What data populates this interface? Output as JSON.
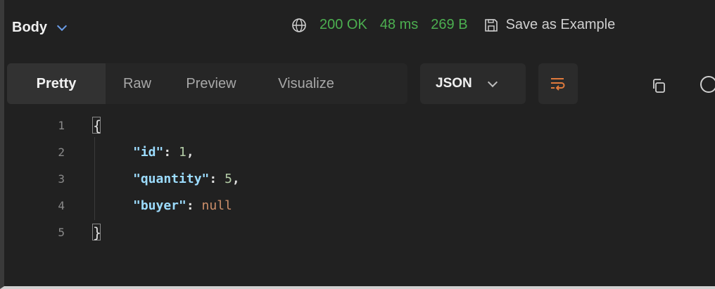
{
  "response_bar": {
    "body_label": "Body",
    "status_code": "200 OK",
    "time": "48 ms",
    "size": "269 B",
    "save_label": "Save as Example",
    "status_color": "#4caf50"
  },
  "tabs": [
    {
      "label": "Pretty",
      "active": true
    },
    {
      "label": "Raw",
      "active": false
    },
    {
      "label": "Preview",
      "active": false
    },
    {
      "label": "Visualize",
      "active": false
    }
  ],
  "format": {
    "selected": "JSON"
  },
  "toolbar_icons": {
    "wrap": "wrap-lines-icon",
    "copy": "copy-icon",
    "search": "search-icon"
  },
  "code": {
    "line_numbers": [
      "1",
      "2",
      "3",
      "4",
      "5"
    ],
    "open_brace": "{",
    "close_brace": "}",
    "entries": [
      {
        "key": "\"id\"",
        "sep": ": ",
        "value": "1",
        "trail": ",",
        "type": "number"
      },
      {
        "key": "\"quantity\"",
        "sep": ": ",
        "value": "5",
        "trail": ",",
        "type": "number"
      },
      {
        "key": "\"buyer\"",
        "sep": ": ",
        "value": "null",
        "trail": "",
        "type": "null"
      }
    ]
  }
}
